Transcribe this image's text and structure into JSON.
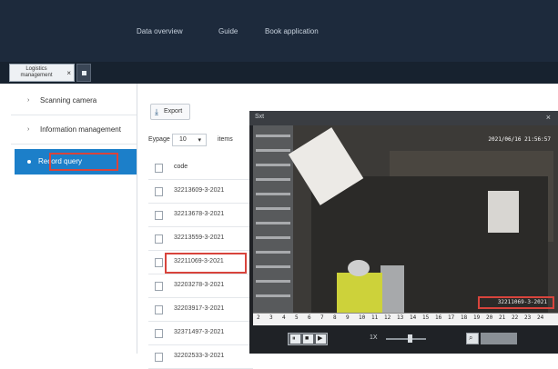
{
  "topnav": {
    "items": [
      {
        "label": "Data overview"
      },
      {
        "label": "Guide"
      },
      {
        "label": "Book application"
      }
    ]
  },
  "tabs": {
    "active_label": "Logistics management",
    "close_glyph": "×"
  },
  "sidebar": {
    "items": [
      {
        "label": "Scanning camera",
        "caret": "›"
      },
      {
        "label": "Information management",
        "caret": "›"
      },
      {
        "label": "Record query",
        "active": true
      }
    ]
  },
  "toolbar": {
    "export_label": "Export",
    "export_icon": "download-icon"
  },
  "pagination": {
    "prefix": "Eypage",
    "page_size": "10",
    "suffix": "items"
  },
  "table": {
    "header": "code",
    "rows": [
      "32213609-3-2021",
      "32213678-3-2021",
      "32213559-3-2021",
      "32211069-3-2021",
      "32203278-3-2021",
      "32203917-3-2021",
      "32371497-3-2021",
      "32202533-3-2021"
    ],
    "highlighted_row_index": 3
  },
  "popup": {
    "title": "Sxt",
    "close_glyph": "×",
    "timestamp": "2021/06/16 21:56:57",
    "overlay_code": "32211069-3-2021",
    "timeline_ticks": [
      "2",
      "3",
      "4",
      "5",
      "6",
      "7",
      "8",
      "9",
      "10",
      "11",
      "12",
      "13",
      "14",
      "15",
      "16",
      "17",
      "18",
      "19",
      "20",
      "21",
      "22",
      "23",
      "24"
    ],
    "speed": "1X",
    "controls": {
      "pause": "⏸",
      "stop": "■",
      "next": "▶"
    }
  },
  "colors": {
    "nav_bg": "#1d2a3c",
    "accent": "#1c7fc9",
    "highlight": "#d8443c"
  }
}
